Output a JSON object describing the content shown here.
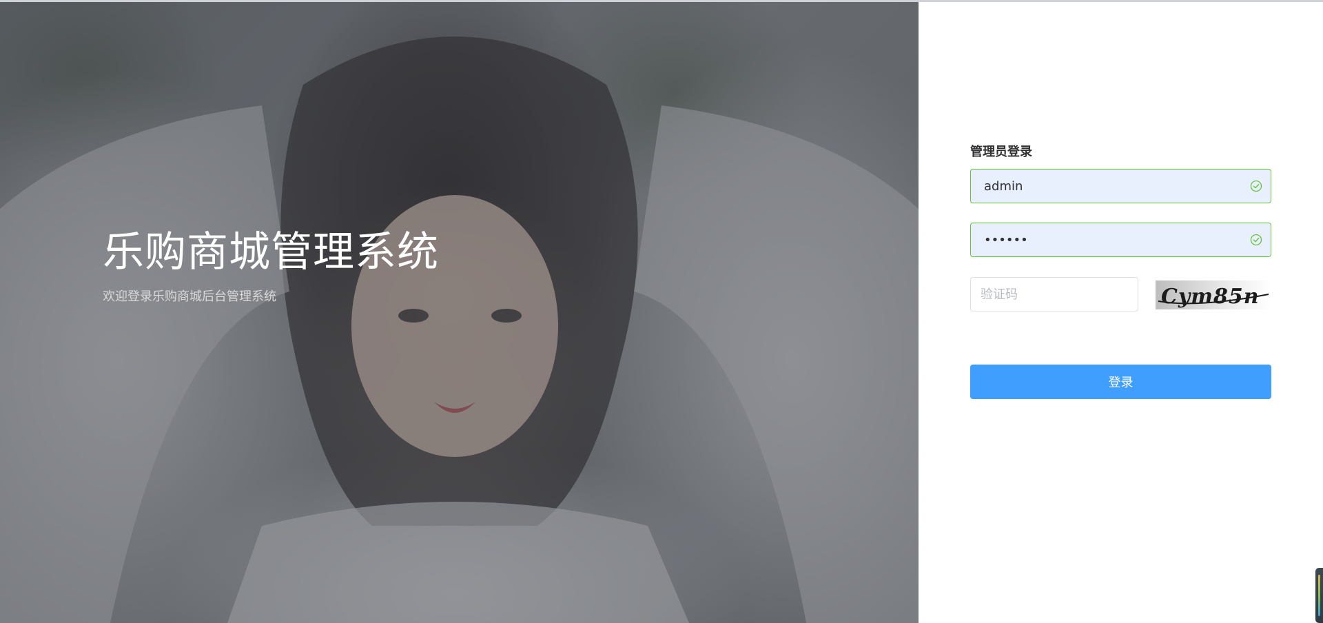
{
  "hero": {
    "title": "乐购商城管理系统",
    "subtitle": "欢迎登录乐购商城后台管理系统"
  },
  "login": {
    "heading": "管理员登录",
    "username_value": "admin",
    "password_value": "••••••",
    "captcha_placeholder": "验证码",
    "captcha_image_text": "Cym85n",
    "submit_label": "登录"
  },
  "colors": {
    "primary": "#409eff",
    "success": "#67c23a",
    "autofill_bg": "#e8f0fe"
  },
  "icons": {
    "username_valid": "circle-check-icon",
    "password_valid": "circle-check-icon"
  }
}
